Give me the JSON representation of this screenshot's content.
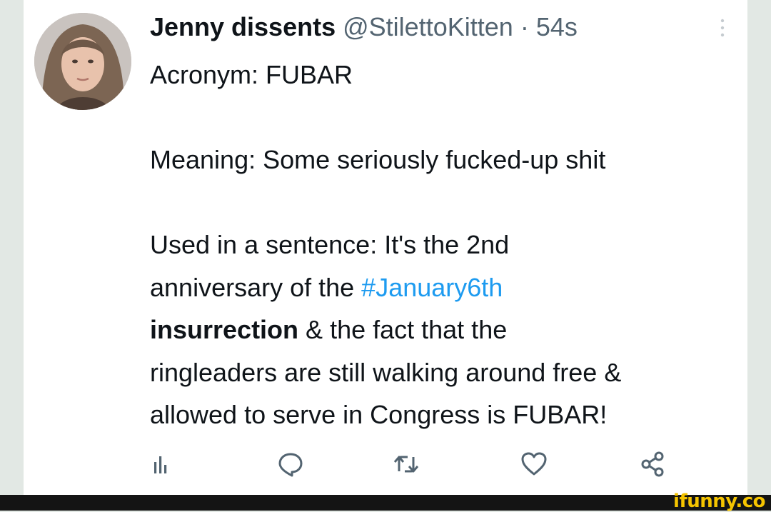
{
  "tweet": {
    "author": {
      "display_name": "Jenny dissents",
      "handle": "@StilettoKitten",
      "separator": "·",
      "time": "54s"
    },
    "lines": {
      "acronym": "Acronym: FUBAR",
      "meaning": "Meaning: Some seriously fucked-up shit",
      "used_1": "Used in a sentence: It's the 2nd",
      "used_2_prefix": "anniversary of the",
      "hashtag": "#January6th",
      "used_3_bold": "insurrection",
      "used_3_rest": " & the fact that the",
      "used_4": "ringleaders are still walking around free &",
      "used_5": "allowed to serve in Congress is FUBAR!"
    },
    "actions": [
      {
        "icon": "analytics-icon"
      },
      {
        "icon": "reply-icon"
      },
      {
        "icon": "retweet-icon"
      },
      {
        "icon": "like-icon"
      },
      {
        "icon": "share-icon"
      }
    ],
    "colors": {
      "text": "#0f1419",
      "secondary": "#536471",
      "hashtag": "#1d9bf0"
    }
  },
  "watermark": {
    "brand": "ifunny.co",
    "color": "#f5c400"
  }
}
